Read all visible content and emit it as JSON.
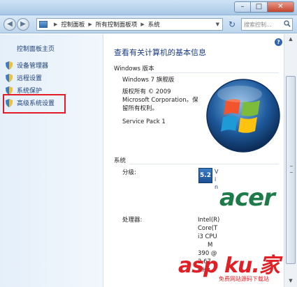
{
  "window": {
    "controls": {
      "minimize": "–",
      "maximize": "□",
      "close": "✕"
    }
  },
  "toolbar": {
    "breadcrumbs": [
      "控制面板",
      "所有控制面板项",
      "系统"
    ],
    "search_placeholder": "搜索控制...",
    "icons": [
      "back-arrow-icon",
      "forward-arrow-icon",
      "refresh-icon",
      "search-icon"
    ]
  },
  "sidebar": {
    "home_label": "控制面板主页",
    "tasks": [
      {
        "label": "设备管理器",
        "icon": "shield-icon"
      },
      {
        "label": "远程设置",
        "icon": "shield-icon"
      },
      {
        "label": "系统保护",
        "icon": "shield-icon"
      },
      {
        "label": "高级系统设置",
        "icon": "shield-icon",
        "highlighted": true
      }
    ],
    "highlight_color": "#e21b24"
  },
  "main": {
    "heading": "查看有关计算机的基本信息",
    "edition_section": "Windows 版本",
    "edition_name": "Windows 7 旗舰版",
    "copyright_lines": [
      "版权所有 © 2009",
      "Microsoft Corporation。保",
      "留所有权利。"
    ],
    "service_pack": "Service Pack 1",
    "system_section": "系统",
    "rating_label": "分级:",
    "rating_value": "5.2",
    "rating_link": [
      "V",
      "i",
      "n"
    ],
    "processor_label": "处理器:",
    "processor_lines": [
      "Intel(R)",
      "Core(T",
      "i3 CPU",
      "M",
      "390 @",
      "2.67",
      "GHz"
    ],
    "oem_logo": "acer",
    "heading_color": "#1a3c87"
  },
  "watermark": {
    "main": "asp ku.家",
    "sub": "免费网站源码下载站"
  }
}
